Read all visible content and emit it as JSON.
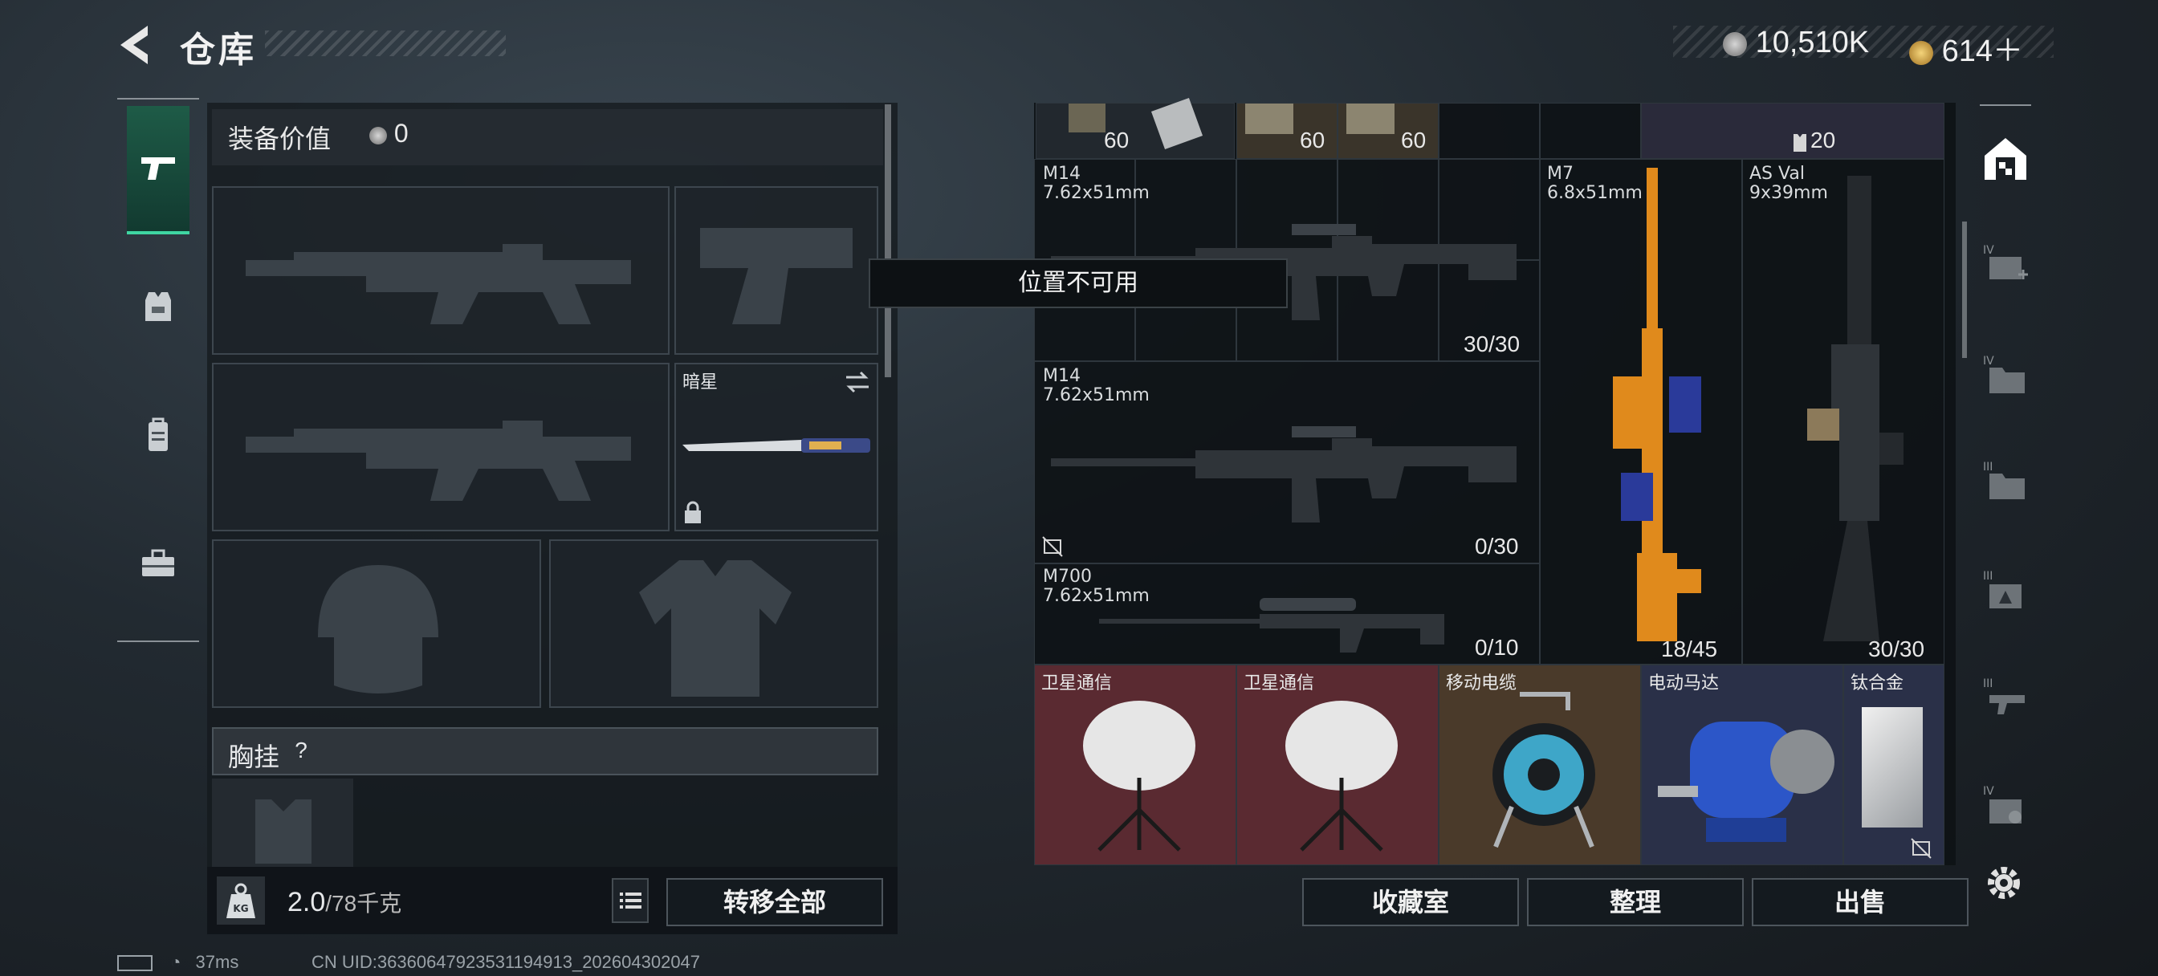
{
  "header": {
    "title": "仓库",
    "currency_silver": "10,510K",
    "currency_gold": "614＋"
  },
  "left": {
    "equip_value_label": "装备价值",
    "equip_value": "0",
    "melee_name": "暗星",
    "chest_label": "胸挂",
    "chest_help": "?",
    "weight_current": "2.0",
    "weight_max": "/78千克",
    "transfer_all": "转移全部"
  },
  "tooltip": "位置不可用",
  "grid": {
    "top_counts": [
      "60",
      "60",
      "60",
      "20"
    ],
    "weapons": [
      {
        "name": "M14",
        "caliber": "7.62x51mm",
        "ammo": "30/30"
      },
      {
        "name": "M14",
        "caliber": "7.62x51mm",
        "ammo": "0/30"
      },
      {
        "name": "M700",
        "caliber": "7.62x51mm",
        "ammo": "0/10"
      },
      {
        "name": "M7",
        "caliber": "6.8x51mm",
        "ammo": "18/45"
      },
      {
        "name": "AS Val",
        "caliber": "9x39mm",
        "ammo": "30/30"
      }
    ],
    "items": [
      {
        "name": "卫星通信"
      },
      {
        "name": "卫星通信"
      },
      {
        "name": "移动电缆"
      },
      {
        "name": "电动马达"
      },
      {
        "name": "钛合金"
      }
    ]
  },
  "buttons": {
    "collection": "收藏室",
    "organize": "整理",
    "sell": "出售"
  },
  "status": {
    "ping": "37ms",
    "uid": "CN UID:36360647923531194913_202604302047"
  },
  "colors": {
    "accent": "#3fd6a2",
    "rarity_red": "#5a2a31",
    "rarity_orange": "#4a3a2a",
    "rarity_blue": "#2a3048"
  }
}
